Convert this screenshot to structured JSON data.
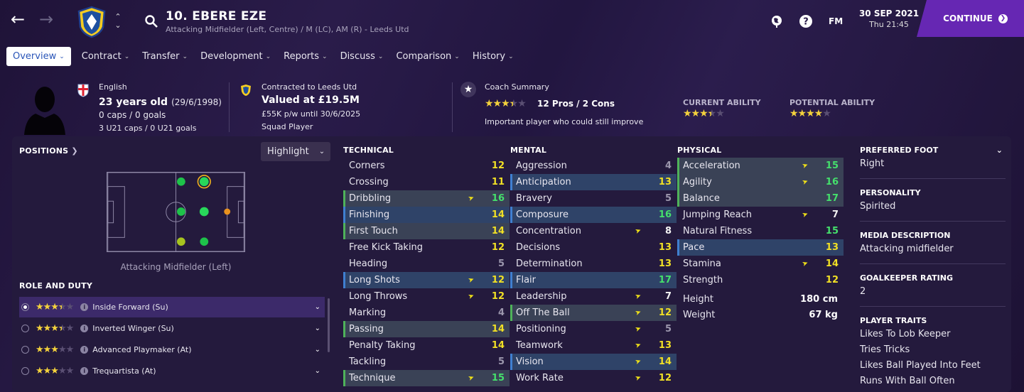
{
  "header": {
    "player_name": "10. EBERE EZE",
    "subtitle": "Attacking Midfielder (Left, Centre) / M (LC), AM (R) - Leeds Utd",
    "fm_label": "FM",
    "date": "30 SEP 2021",
    "time": "Thu 21:45",
    "continue_label": "CONTINUE"
  },
  "tabs": [
    {
      "label": "Overview"
    },
    {
      "label": "Contract"
    },
    {
      "label": "Transfer"
    },
    {
      "label": "Development"
    },
    {
      "label": "Reports"
    },
    {
      "label": "Discuss"
    },
    {
      "label": "Comparison"
    },
    {
      "label": "History"
    }
  ],
  "info": {
    "nationality": "English",
    "age": "23 years old",
    "dob": "(29/6/1998)",
    "caps": "0 caps / 0 goals",
    "u21": "3 U21 caps / 0 U21 goals",
    "contract": "Contracted to Leeds Utd",
    "value": "Valued at £19.5M",
    "wage": "£55K p/w until 30/6/2025",
    "status": "Squad Player",
    "coach_title": "Coach Summary",
    "coach_proscons": "12 Pros / 2 Cons",
    "coach_note": "Important player who could still improve",
    "current_ability_label": "CURRENT ABILITY",
    "potential_ability_label": "POTENTIAL ABILITY",
    "coach_stars": 3.5,
    "current_stars": 3.5,
    "potential_stars": 4
  },
  "positions": {
    "title": "POSITIONS",
    "highlight_label": "Highlight",
    "position_caption": "Attacking Midfielder (Left)"
  },
  "roles": {
    "title": "ROLE AND DUTY",
    "items": [
      {
        "name": "Inside Forward (Su)",
        "stars": 3.5
      },
      {
        "name": "Inverted Winger (Su)",
        "stars": 3.5
      },
      {
        "name": "Advanced Playmaker (At)",
        "stars": 3
      },
      {
        "name": "Trequartista (At)",
        "stars": 3
      }
    ]
  },
  "technical": {
    "title": "TECHNICAL",
    "rows": [
      {
        "name": "Corners",
        "value": "12"
      },
      {
        "name": "Crossing",
        "value": "11"
      },
      {
        "name": "Dribbling",
        "value": "16"
      },
      {
        "name": "Finishing",
        "value": "14"
      },
      {
        "name": "First Touch",
        "value": "14"
      },
      {
        "name": "Free Kick Taking",
        "value": "12"
      },
      {
        "name": "Heading",
        "value": "5"
      },
      {
        "name": "Long Shots",
        "value": "12"
      },
      {
        "name": "Long Throws",
        "value": "12"
      },
      {
        "name": "Marking",
        "value": "4"
      },
      {
        "name": "Passing",
        "value": "14"
      },
      {
        "name": "Penalty Taking",
        "value": "14"
      },
      {
        "name": "Tackling",
        "value": "5"
      },
      {
        "name": "Technique",
        "value": "15"
      }
    ]
  },
  "mental": {
    "title": "MENTAL",
    "rows": [
      {
        "name": "Aggression",
        "value": "4"
      },
      {
        "name": "Anticipation",
        "value": "13"
      },
      {
        "name": "Bravery",
        "value": "5"
      },
      {
        "name": "Composure",
        "value": "16"
      },
      {
        "name": "Concentration",
        "value": "8"
      },
      {
        "name": "Decisions",
        "value": "13"
      },
      {
        "name": "Determination",
        "value": "13"
      },
      {
        "name": "Flair",
        "value": "17"
      },
      {
        "name": "Leadership",
        "value": "7"
      },
      {
        "name": "Off The Ball",
        "value": "12"
      },
      {
        "name": "Positioning",
        "value": "5"
      },
      {
        "name": "Teamwork",
        "value": "13"
      },
      {
        "name": "Vision",
        "value": "14"
      },
      {
        "name": "Work Rate",
        "value": "12"
      }
    ]
  },
  "physical": {
    "title": "PHYSICAL",
    "rows": [
      {
        "name": "Acceleration",
        "value": "15"
      },
      {
        "name": "Agility",
        "value": "16"
      },
      {
        "name": "Balance",
        "value": "17"
      },
      {
        "name": "Jumping Reach",
        "value": "7"
      },
      {
        "name": "Natural Fitness",
        "value": "15"
      },
      {
        "name": "Pace",
        "value": "13"
      },
      {
        "name": "Stamina",
        "value": "14"
      },
      {
        "name": "Strength",
        "value": "12"
      }
    ],
    "height_label": "Height",
    "height": "180 cm",
    "weight_label": "Weight",
    "weight": "67 kg"
  },
  "details": {
    "foot_label": "PREFERRED FOOT",
    "foot": "Right",
    "personality_label": "PERSONALITY",
    "personality": "Spirited",
    "media_label": "MEDIA DESCRIPTION",
    "media": "Attacking midfielder",
    "gk_label": "GOALKEEPER RATING",
    "gk": "2",
    "traits_label": "PLAYER TRAITS",
    "traits": [
      "Likes To Lob Keeper",
      "Tries Tricks",
      "Likes Ball Played Into Feet",
      "Runs With Ball Often"
    ]
  }
}
